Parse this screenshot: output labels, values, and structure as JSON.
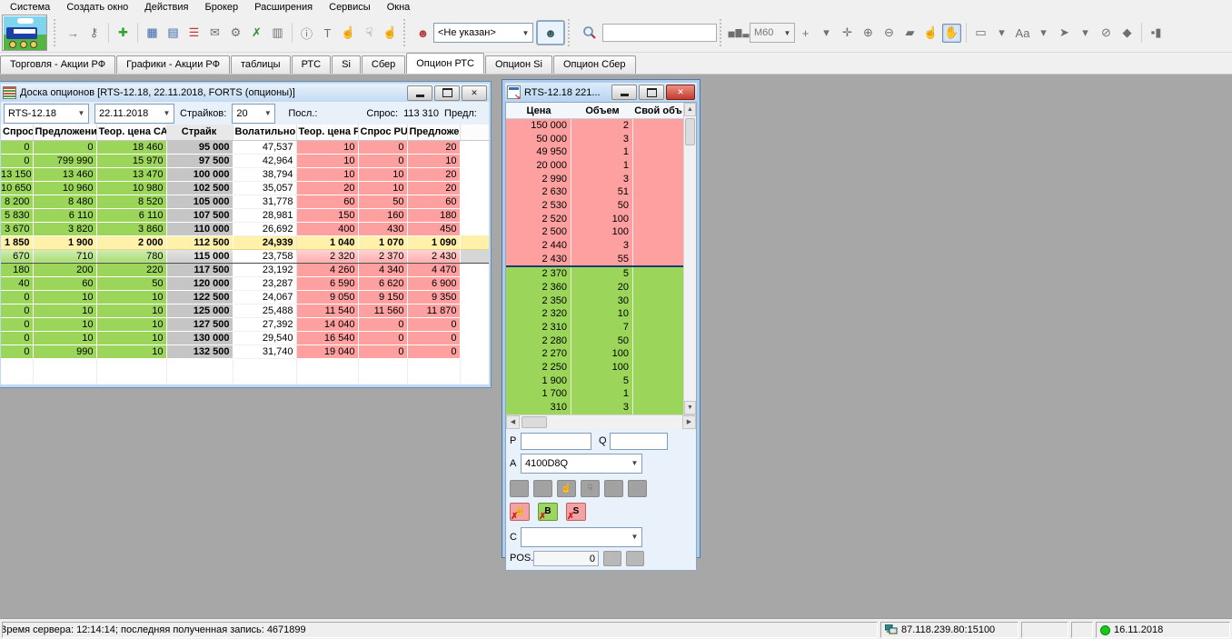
{
  "colors": {
    "bid_green": "#9BD65A",
    "ask_pink": "#FFA0A0",
    "atm_yellow": "#FFF0AA",
    "strike_gray": "#C5C5C5",
    "active_close_red": "#C23B2E"
  },
  "menu_bar": {
    "items": [
      "Система",
      "Создать окно",
      "Действия",
      "Брокер",
      "Расширения",
      "Сервисы",
      "Окна"
    ]
  },
  "toolbar": {
    "left_icons": [
      {
        "name": "connect-icon",
        "glyph": "→"
      },
      {
        "name": "disconnect-key-icon",
        "glyph": "⚷"
      },
      {
        "sep": true
      },
      {
        "name": "new-window-icon",
        "glyph": "✚",
        "color": "#2FA32F"
      },
      {
        "sep": true
      },
      {
        "name": "chart-window-icon",
        "glyph": "▦",
        "color": "#3A66A8"
      },
      {
        "name": "quotes-window-icon",
        "glyph": "▤",
        "color": "#3A66A8"
      },
      {
        "name": "table-window-icon",
        "glyph": "☰",
        "color": "#C03A3A"
      },
      {
        "name": "message-icon",
        "glyph": "✉"
      },
      {
        "name": "settings-icon",
        "glyph": "⚙"
      },
      {
        "name": "excel-export-icon",
        "glyph": "✗",
        "color": "#2E8B2E"
      },
      {
        "name": "journal-icon",
        "glyph": "▥"
      },
      {
        "sep": true
      },
      {
        "name": "info-balloon-icon",
        "glyph": "ⓘ"
      },
      {
        "name": "text-label-icon",
        "glyph": "T"
      },
      {
        "name": "pointer-hand-icon",
        "glyph": "☝"
      },
      {
        "name": "hand-disabled-icon",
        "glyph": "☟"
      },
      {
        "name": "hand-small-icon",
        "glyph": "☝"
      }
    ],
    "client_icon": "client-remove-icon",
    "client_dropdown_value": "<Не указан>",
    "person_button": "client-select-button",
    "search_value": "",
    "interval_value": "M60",
    "right_icons": [
      {
        "name": "add-series-icon",
        "glyph": "+"
      },
      {
        "name": "add-dropdown-icon",
        "glyph": "▾"
      },
      {
        "name": "move-chart-icon",
        "glyph": "✛"
      },
      {
        "name": "zoom-in-icon",
        "glyph": "⊕"
      },
      {
        "name": "zoom-out-icon",
        "glyph": "⊖"
      },
      {
        "name": "eraser-icon",
        "glyph": "▰"
      },
      {
        "name": "point-hand-icon",
        "glyph": "☝"
      },
      {
        "name": "drag-hand-icon",
        "glyph": "✋",
        "pressed": true
      },
      {
        "sep": true
      },
      {
        "name": "region-select-icon",
        "glyph": "▭"
      },
      {
        "name": "region-dropdown-icon",
        "glyph": "▾"
      },
      {
        "name": "text-tool-icon",
        "glyph": "Aa"
      },
      {
        "name": "text-dropdown-icon",
        "glyph": "▾"
      },
      {
        "name": "draw-tool-icon",
        "glyph": "➤"
      },
      {
        "name": "draw-dropdown-icon",
        "glyph": "▾"
      },
      {
        "name": "hide-series-icon",
        "glyph": "⊘"
      },
      {
        "name": "indicator-icon",
        "glyph": "◆"
      },
      {
        "sep": true
      },
      {
        "name": "volume-bars-icon",
        "glyph": "▪▮"
      }
    ]
  },
  "tabs": {
    "items": [
      "Торговля - Акции РФ",
      "Графики - Акции РФ",
      "таблицы",
      "РТС",
      "Si",
      "Сбер",
      "Опцион РТС",
      "Опцион Si",
      "Опцион Сбер"
    ],
    "active": "Опцион РТС"
  },
  "options_window": {
    "title": "Доска опционов [RTS-12.18, 22.11.2018, FORTS (опционы)]",
    "controls": {
      "instrument": "RTS-12.18",
      "date": "22.11.2018",
      "strikes_label": "Страйков:",
      "strikes": "20",
      "last_label": "Посл.:",
      "demand_label": "Спрос:",
      "demand_value": "113 310",
      "supply_label": "Предл:"
    },
    "table": {
      "headers": [
        "Спрос",
        "Предложени",
        "Теор. цена СА",
        "Страйк",
        "Волатильно",
        "Теор. цена P",
        "Спрос PU",
        "Предложе"
      ],
      "atm_strike": "112 500",
      "selected_strike": "115 000",
      "rows": [
        [
          "0",
          "0",
          "18 460",
          "95 000",
          "47,537",
          "10",
          "0",
          "20"
        ],
        [
          "0",
          "799 990",
          "15 970",
          "97 500",
          "42,964",
          "10",
          "0",
          "10"
        ],
        [
          "13 150",
          "13 460",
          "13 470",
          "100 000",
          "38,794",
          "10",
          "10",
          "20"
        ],
        [
          "10 650",
          "10 960",
          "10 980",
          "102 500",
          "35,057",
          "20",
          "10",
          "20"
        ],
        [
          "8 200",
          "8 480",
          "8 520",
          "105 000",
          "31,778",
          "60",
          "50",
          "60"
        ],
        [
          "5 830",
          "6 110",
          "6 110",
          "107 500",
          "28,981",
          "150",
          "160",
          "180"
        ],
        [
          "3 670",
          "3 820",
          "3 860",
          "110 000",
          "26,692",
          "400",
          "430",
          "450"
        ],
        [
          "1 850",
          "1 900",
          "2 000",
          "112 500",
          "24,939",
          "1 040",
          "1 070",
          "1 090"
        ],
        [
          "670",
          "710",
          "780",
          "115 000",
          "23,758",
          "2 320",
          "2 370",
          "2 430"
        ],
        [
          "180",
          "200",
          "220",
          "117 500",
          "23,192",
          "4 260",
          "4 340",
          "4 470"
        ],
        [
          "40",
          "60",
          "50",
          "120 000",
          "23,287",
          "6 590",
          "6 620",
          "6 900"
        ],
        [
          "0",
          "10",
          "10",
          "122 500",
          "24,067",
          "9 050",
          "9 150",
          "9 350"
        ],
        [
          "0",
          "10",
          "10",
          "125 000",
          "25,488",
          "11 540",
          "11 560",
          "11 870"
        ],
        [
          "0",
          "10",
          "10",
          "127 500",
          "27,392",
          "14 040",
          "0",
          "0"
        ],
        [
          "0",
          "10",
          "10",
          "130 000",
          "29,540",
          "16 540",
          "0",
          "0"
        ],
        [
          "0",
          "990",
          "10",
          "132 500",
          "31,740",
          "19 040",
          "0",
          "0"
        ]
      ]
    }
  },
  "orderbook_window": {
    "title": "RTS-12.18  221...",
    "headers": [
      "Цена",
      "Объем",
      "Свой объ"
    ],
    "asks": [
      [
        "150 000",
        "2"
      ],
      [
        "50 000",
        "3"
      ],
      [
        "49 950",
        "1"
      ],
      [
        "20 000",
        "1"
      ],
      [
        "2 990",
        "3"
      ],
      [
        "2 630",
        "51"
      ],
      [
        "2 530",
        "50"
      ],
      [
        "2 520",
        "100"
      ],
      [
        "2 500",
        "100"
      ],
      [
        "2 440",
        "3"
      ],
      [
        "2 430",
        "55"
      ]
    ],
    "bids": [
      [
        "2 370",
        "5"
      ],
      [
        "2 360",
        "20"
      ],
      [
        "2 350",
        "30"
      ],
      [
        "2 320",
        "10"
      ],
      [
        "2 310",
        "7"
      ],
      [
        "2 280",
        "50"
      ],
      [
        "2 270",
        "100"
      ],
      [
        "2 250",
        "100"
      ],
      [
        "1 900",
        "5"
      ],
      [
        "1 700",
        "1"
      ],
      [
        "310",
        "3"
      ]
    ],
    "panel": {
      "p_label": "P",
      "p_value": "",
      "q_label": "Q",
      "q_value": "",
      "a_label": "A",
      "a_value": "4100D8Q",
      "buy_button_label": "B",
      "sell_button_label": "S",
      "c_label": "C",
      "c_value": "",
      "pos_label": "POS.",
      "pos_value": "0"
    }
  },
  "status_bar": {
    "server_text": "Время сервера: 12:14:14; последняя полученная запись: 4671899",
    "ip": "87.118.239.80:15100",
    "date": "16.11.2018"
  }
}
